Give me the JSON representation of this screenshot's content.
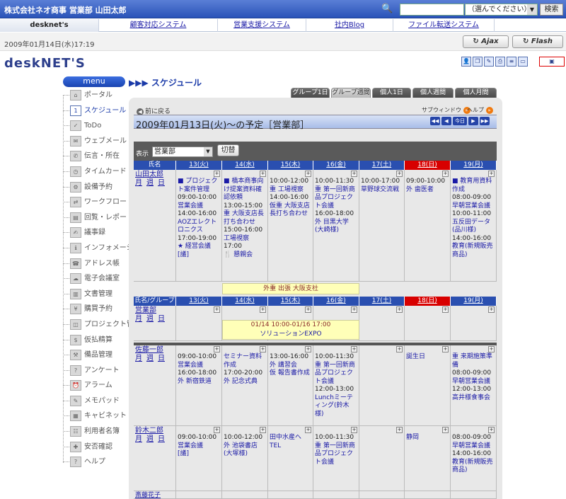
{
  "header": {
    "company": "株式会社ネオ商事 営業部 山田太郎",
    "search_select": "（選んでください）",
    "search_button": "検索"
  },
  "topnav": {
    "brand": "desknet's",
    "links": [
      "顧客対応システム",
      "営業支援システム",
      "社内Blog",
      "ファイル転送システム"
    ]
  },
  "datebar": {
    "datetime": "2009年01月14日(水)17:19",
    "ajax": "Ajax",
    "flash": "Flash"
  },
  "logo": "desknet's",
  "menu": {
    "title": "menu",
    "items": [
      "ポータル",
      "スケジュール",
      "ToDo",
      "ウェブメール",
      "伝言・所在",
      "タイムカード",
      "設備予約",
      "ワークフロー",
      "回覧・レポート",
      "議事録",
      "インフォメーション",
      "アドレス帳",
      "電子会議室",
      "文書管理",
      "購買予約",
      "プロジェクト管理",
      "仮払精算",
      "備品管理",
      "アンケート",
      "アラーム",
      "メモパッド",
      "キャビネット",
      "利用者名簿",
      "安否確認",
      "ヘルプ"
    ],
    "active_index": 1
  },
  "page": {
    "heading": "スケジュール",
    "view_tabs": [
      "グループ1日",
      "グループ週間",
      "個人1日",
      "個人週間",
      "個人月間"
    ],
    "active_tab": 1,
    "back": "前に戻る",
    "subwindow": "サブウィンドウ",
    "help": "ヘルプ",
    "title": "2009年01月13日(火)～の予定［営業部］",
    "today": "今日",
    "filter_label": "表示",
    "filter_value": "営業部",
    "switch": "切替"
  },
  "week": {
    "name_header": "氏名",
    "group_header": "氏名/グループ",
    "days": [
      "13(火)",
      "14(水)",
      "15(木)",
      "16(金)",
      "17(土)",
      "18(日)",
      "19(月)"
    ],
    "links": {
      "m": "月",
      "w": "週",
      "d": "日",
      "l": "伝言"
    }
  },
  "rows": [
    {
      "name": "山田太郎",
      "cells": [
        [
          "■ プロジェクト案件管理",
          "09:00-10:00",
          "営業会議",
          "14:00-16:00",
          "AOZエレクトロニクス",
          "17:00-19:00",
          "★ 経営会議",
          "[議]"
        ],
        [
          "■ 橋本商事向け提案資料確認依頼",
          "13:00-15:00",
          "重 大阪支店長打ち合わせ",
          "15:00-16:00",
          "工場視察",
          "17:00",
          "🍴 懇親会"
        ],
        [
          "10:00-12:00",
          "重 工場視察",
          "14:00-16:00",
          "仮重 大阪支店長打ち合わせ"
        ],
        [
          "10:00-11:30",
          "重 第一回新商品プロジェクト会議",
          "16:00-18:00",
          "外 目黒大学(大崎様)"
        ],
        [
          "10:00-17:00",
          "草野球交流戦"
        ],
        [
          "09:00-10:00",
          "外 歯医者"
        ],
        [
          "■ 教育用資料作成",
          "08:00-09:00",
          "早朝営業会議",
          "10:00-11:00",
          "五反田データ(品川様)",
          "14:00-16:00",
          "教育(新規販売商品)"
        ]
      ],
      "banner": "外重 出張 大阪支社"
    },
    {
      "name": "営業部",
      "banner_time": "01/14 10:00-01/16 17:00",
      "banner_text": "ソリューションEXPO"
    },
    {
      "name": "佐藤一郎",
      "cells": [
        [
          "09:00-10:00",
          "営業会議",
          "16:00-18:00",
          "外 新宿鉄道"
        ],
        [
          "セミナー資料作成",
          "17:00-20:00",
          "外 記念式典"
        ],
        [
          "13:00-16:00",
          "外 講習会",
          "仮 報告書作成"
        ],
        [
          "10:00-11:30",
          "重 第一回新商品プロジェクト会議",
          "12:00-13:00",
          "Lunchミーティング(鈴木様)"
        ],
        [],
        [
          "誕生日"
        ],
        [
          "重 来期施策準備",
          "08:00-09:00",
          "早朝営業会議",
          "12:00-13:00",
          "高井様食事会"
        ]
      ]
    },
    {
      "name": "鈴木二郎",
      "cells": [
        [
          "09:00-10:00",
          "営業会議",
          "[議]"
        ],
        [
          "10:00-12:00",
          "外 池袋書店(大塚様)"
        ],
        [
          "田中水産へTEL"
        ],
        [
          "10:00-11:30",
          "重 第一回新商品プロジェクト会議"
        ],
        [],
        [
          "静岡"
        ],
        [
          "08:00-09:00",
          "早朝営業会議",
          "14:00-16:00",
          "教育(新規販売商品)"
        ]
      ]
    },
    {
      "name": "斎藤花子"
    }
  ]
}
